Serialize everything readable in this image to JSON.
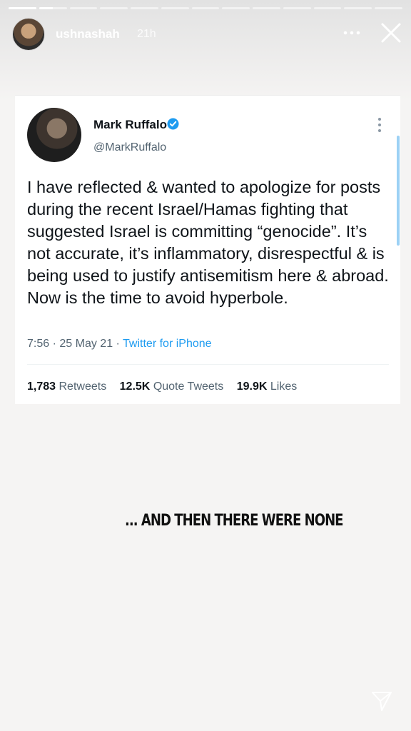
{
  "story": {
    "segments": 13,
    "active_segment_index": 1,
    "active_progress": 0.5,
    "username": "ushnashah",
    "time": "21h",
    "more_icon": "more-horizontal-icon",
    "close_icon": "close-icon",
    "caption": "... AND THEN THERE WERE NONE",
    "send_icon": "send-icon"
  },
  "tweet": {
    "author_name": "Mark Ruffalo",
    "handle": "@MarkRuffalo",
    "verified": true,
    "verified_color": "#1d9bf0",
    "text": "I have reflected & wanted to apologize for posts during the recent Israel/Hamas fighting that suggested Israel is committing “genocide”. It’s not accurate, it’s inflammatory, disrespectful & is being used to justify antisemitism here & abroad. Now is the time to avoid hyperbole.",
    "time": "7:56",
    "separator": "·",
    "date": "25 May 21",
    "client": "Twitter for iPhone",
    "stats": {
      "retweets_count": "1,783",
      "retweets_label": "Retweets",
      "quotes_count": "12.5K",
      "quotes_label": "Quote Tweets",
      "likes_count": "19.9K",
      "likes_label": "Likes"
    }
  }
}
